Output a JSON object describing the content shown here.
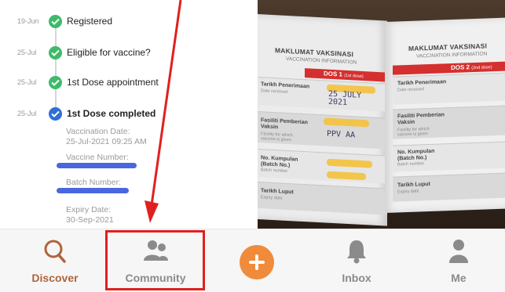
{
  "timeline": {
    "events": [
      {
        "date": "19-Jun",
        "label": "Registered",
        "status": "done",
        "color": "#3dbb6a"
      },
      {
        "date": "25-Jul",
        "label": "Eligible for vaccine?",
        "status": "done",
        "color": "#3dbb6a"
      },
      {
        "date": "25-Jul",
        "label": "1st Dose appointment",
        "status": "done",
        "color": "#3dbb6a"
      },
      {
        "date": "25-Jul",
        "label": "1st Dose completed",
        "status": "current",
        "color": "#2f6fd6"
      }
    ],
    "details": {
      "vaccination_date_label": "Vaccination Date:",
      "vaccination_date_value": "25-Jul-2021 09:25 AM",
      "vaccine_number_label": "Vaccine Number:",
      "batch_number_label": "Batch Number:",
      "expiry_date_label": "Expiry Date:",
      "expiry_date_value": "30-Sep-2021"
    }
  },
  "photo": {
    "left_card": {
      "title": "MAKLUMAT VAKSINASI",
      "subtitle": "VACCINATION INFORMATION",
      "dose_label": "DOS 1",
      "dose_sub": "(1st dose)",
      "fields": [
        {
          "label": "Tarikh Penerimaan",
          "sub": "Date received",
          "handwritten": "25 JULY 2021"
        },
        {
          "label": "Fasiliti Pemberian Vaksin",
          "sub": "Facility for which vaccine is given",
          "handwritten": "PPV AA"
        },
        {
          "label": "No. Kumpulan (Batch No.)",
          "sub": "Batch number",
          "handwritten": ""
        },
        {
          "label": "Tarikh Luput",
          "sub": "Expiry date",
          "handwritten": ""
        }
      ]
    },
    "right_card": {
      "title": "MAKLUMAT VAKSINASI",
      "subtitle": "VACCINATION INFORMATION",
      "dose_label": "DOS 2",
      "dose_sub": "(2nd dose)",
      "fields": [
        {
          "label": "Tarikh Penerimaan",
          "sub": "Date received"
        },
        {
          "label": "Fasiliti Pemberian Vaksin",
          "sub": "Facility for which vaccine is given"
        },
        {
          "label": "No. Kumpulan (Batch No.)",
          "sub": "Batch number"
        },
        {
          "label": "Tarikh Luput",
          "sub": "Expiry date"
        }
      ]
    }
  },
  "nav": {
    "items": [
      {
        "label": "Discover",
        "icon": "search-icon",
        "active": true
      },
      {
        "label": "Community",
        "icon": "people-icon",
        "active": false
      },
      {
        "label": "",
        "icon": "plus-icon",
        "active": false
      },
      {
        "label": "Inbox",
        "icon": "bell-icon",
        "active": false
      },
      {
        "label": "Me",
        "icon": "person-icon",
        "active": false
      }
    ]
  },
  "colors": {
    "accent": "#b0643a",
    "fab": "#ef8b3b",
    "highlight_box": "#e0201e",
    "success": "#3dbb6a",
    "current": "#2f6fd6"
  }
}
